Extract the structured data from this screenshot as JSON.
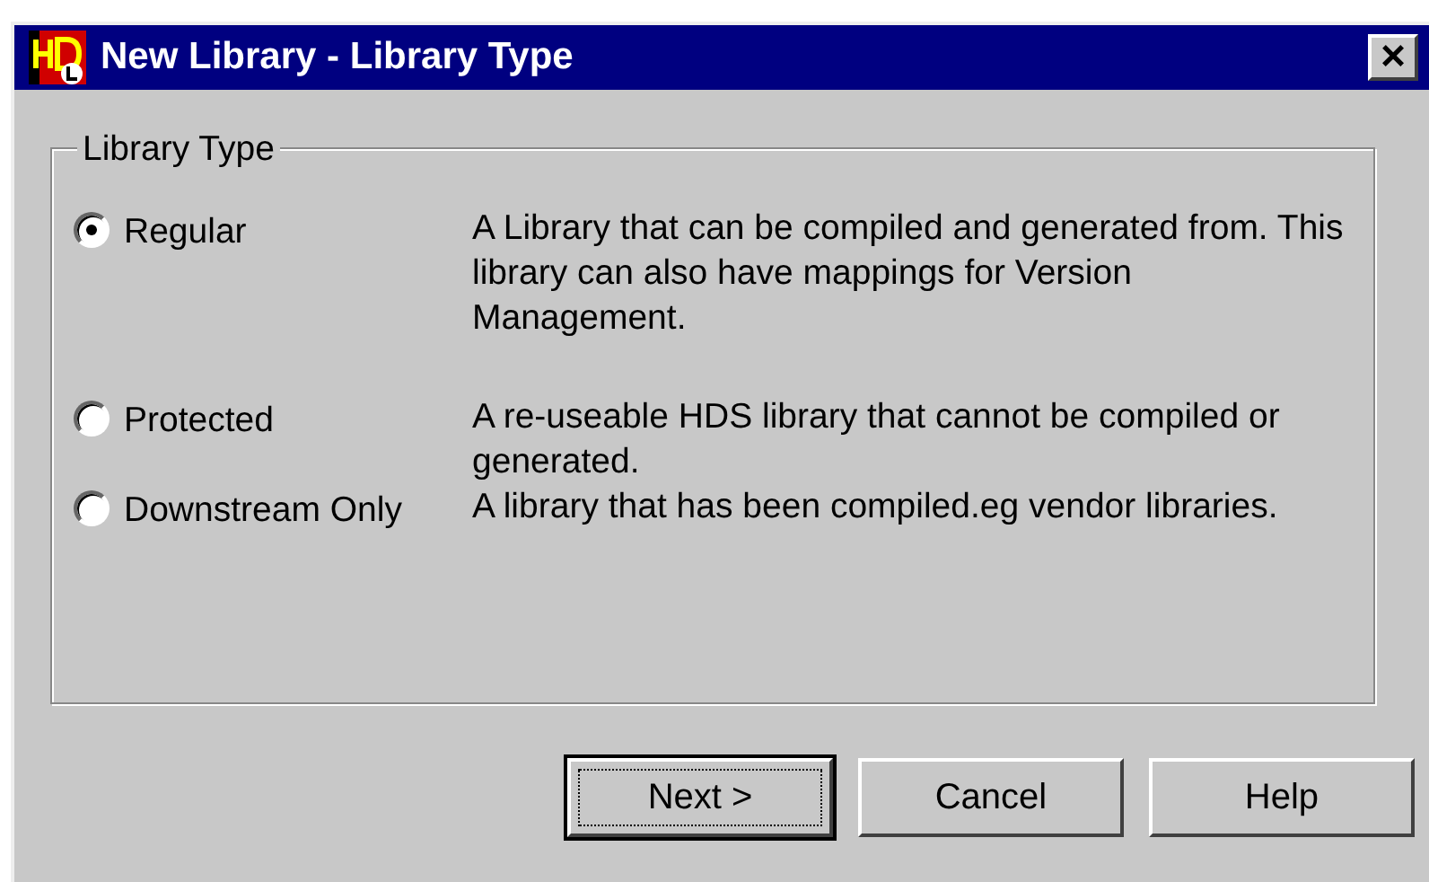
{
  "window": {
    "title": "New Library - Library Type",
    "close": "×"
  },
  "group": {
    "title": "Library Type",
    "options": [
      {
        "label": "Regular",
        "selected": true,
        "description": "A Library that can be compiled and generated from. This library can also have mappings for Version Management."
      },
      {
        "label": "Protected",
        "selected": false,
        "description": "A re-useable HDS library that cannot be compiled or generated."
      },
      {
        "label": "Downstream Only",
        "selected": false,
        "description": "A library that has been compiled.eg vendor libraries."
      }
    ]
  },
  "buttons": [
    {
      "label": "Next >",
      "default": true
    },
    {
      "label": "Cancel",
      "default": false
    },
    {
      "label": "Help",
      "default": false
    }
  ]
}
